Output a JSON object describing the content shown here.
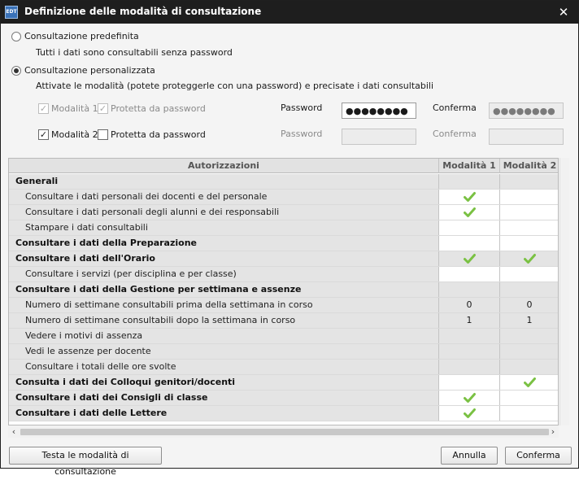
{
  "window": {
    "title": "Definizione delle modalità di consultazione",
    "app_icon_label": "EDT"
  },
  "options": {
    "predefinita": {
      "label": "Consultazione predefinita",
      "description": "Tutti i dati sono consultabili senza password",
      "selected": false
    },
    "personalizzata": {
      "label": "Consultazione personalizzata",
      "description": "Attivate le modalità (potete proteggerle con una password) e precisate i dati consultabili",
      "selected": true
    }
  },
  "modes": [
    {
      "label": "Modalità 1",
      "checked": true,
      "disabled": true,
      "protect_label": "Protetta da password",
      "protect_checked": true,
      "password_label": "Password",
      "password_value": "●●●●●●●●",
      "confirm_label": "Conferma",
      "confirm_value": "●●●●●●●●"
    },
    {
      "label": "Modalità 2",
      "checked": true,
      "disabled": false,
      "protect_label": "Protetta da password",
      "protect_checked": false,
      "password_label": "Password",
      "password_value": "",
      "confirm_label": "Conferma",
      "confirm_value": ""
    }
  ],
  "table": {
    "headers": [
      "Autorizzazioni",
      "Modalità 1",
      "Modalità 2"
    ],
    "rows": [
      {
        "label": "Generali",
        "type": "section",
        "m1": "",
        "m2": "",
        "bg": "grey"
      },
      {
        "label": "Consultare i dati personali dei docenti e del personale",
        "type": "sub",
        "m1": "check",
        "m2": "",
        "bg": "white"
      },
      {
        "label": "Consultare i dati personali degli alunni e dei responsabili",
        "type": "sub",
        "m1": "check",
        "m2": "",
        "bg": "white"
      },
      {
        "label": "Stampare i dati consultabili",
        "type": "sub",
        "m1": "",
        "m2": "",
        "bg": "white"
      },
      {
        "label": "Consultare i dati della Preparazione",
        "type": "section",
        "m1": "",
        "m2": "",
        "bg": "white"
      },
      {
        "label": "Consultare i dati dell'Orario",
        "type": "section",
        "m1": "check",
        "m2": "check",
        "bg": "grey"
      },
      {
        "label": "Consultare i servizi (per disciplina e per classe)",
        "type": "sub",
        "m1": "",
        "m2": "",
        "bg": "white"
      },
      {
        "label": "Consultare i dati della Gestione per settimana e assenze",
        "type": "section",
        "m1": "",
        "m2": "",
        "bg": "grey"
      },
      {
        "label": "Numero di settimane consultabili prima della settimana in corso",
        "type": "sub",
        "m1": "0",
        "m2": "0",
        "bg": "grey"
      },
      {
        "label": "Numero di settimane consultabili dopo la settimana in corso",
        "type": "sub",
        "m1": "1",
        "m2": "1",
        "bg": "grey"
      },
      {
        "label": "Vedere i motivi di assenza",
        "type": "sub",
        "m1": "",
        "m2": "",
        "bg": "grey"
      },
      {
        "label": "Vedi le assenze per docente",
        "type": "sub",
        "m1": "",
        "m2": "",
        "bg": "grey"
      },
      {
        "label": "Consultare i totali delle ore svolte",
        "type": "sub",
        "m1": "",
        "m2": "",
        "bg": "grey"
      },
      {
        "label": "Consulta i dati dei Colloqui genitori/docenti",
        "type": "section",
        "m1": "",
        "m2": "check",
        "bg": "white"
      },
      {
        "label": "Consultare i dati dei Consigli di classe",
        "type": "section",
        "m1": "check",
        "m2": "",
        "bg": "white"
      },
      {
        "label": "Consultare i dati delle Lettere",
        "type": "section",
        "m1": "check",
        "m2": "",
        "bg": "white"
      }
    ]
  },
  "buttons": {
    "test": "Testa le modalità di consultazione",
    "cancel": "Annulla",
    "confirm": "Conferma"
  },
  "colors": {
    "check": "#7ac143",
    "titlebar": "#1e1e1e"
  }
}
